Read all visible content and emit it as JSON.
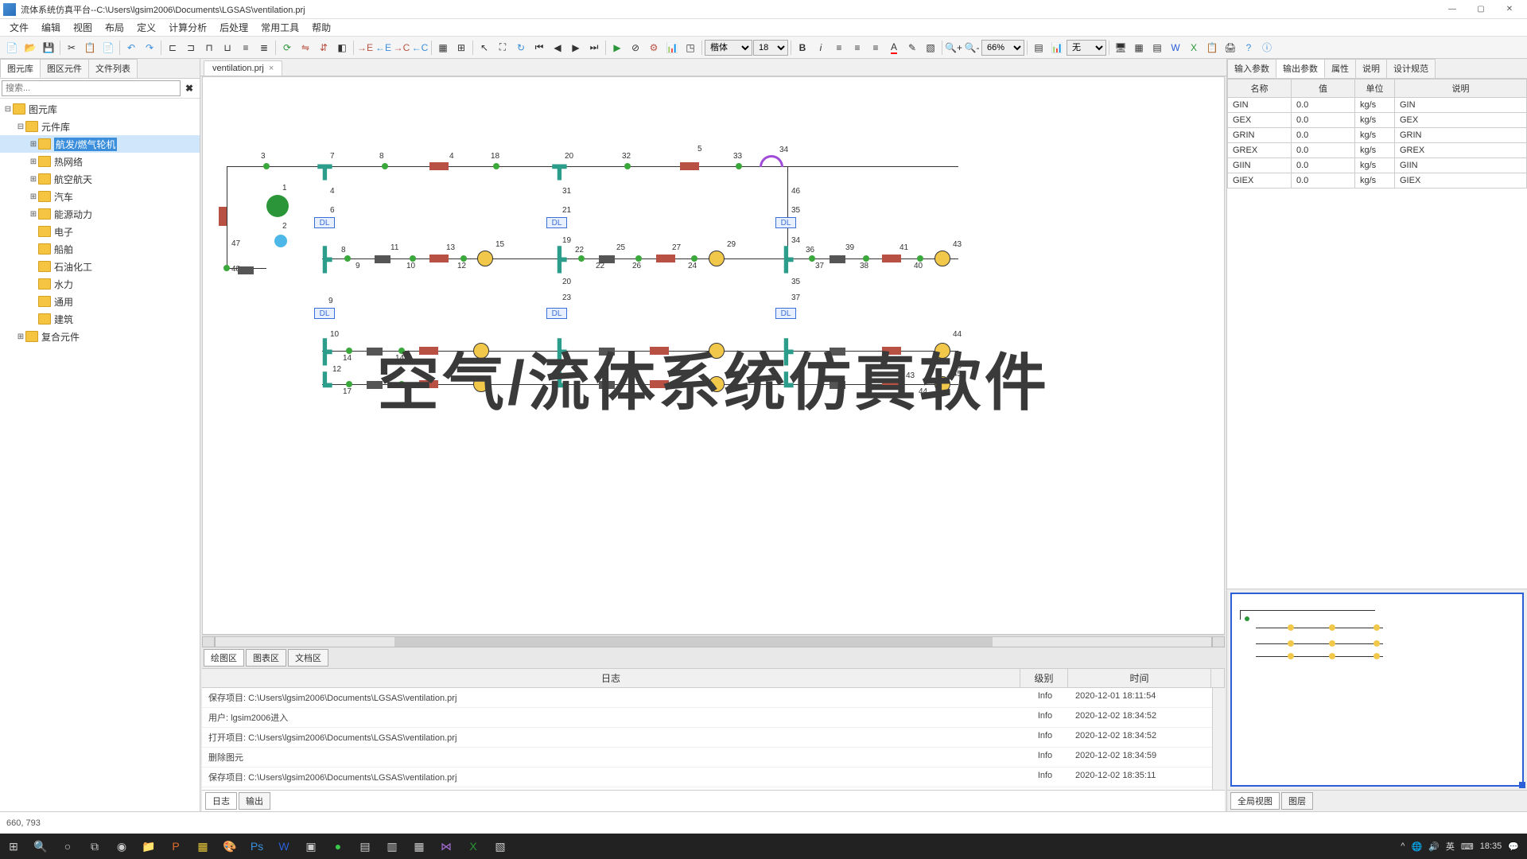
{
  "title": "流体系统仿真平台--C:\\Users\\lgsim2006\\Documents\\LGSAS\\ventilation.prj",
  "menu": [
    "文件",
    "编辑",
    "视图",
    "布局",
    "定义",
    "计算分析",
    "后处理",
    "常用工具",
    "帮助"
  ],
  "toolbar": {
    "font_select": "楷体",
    "font_size": "18",
    "zoom": "66%",
    "layer_select": "无"
  },
  "left_panel": {
    "tabs": [
      "图元库",
      "图区元件",
      "文件列表"
    ],
    "active_tab": 0,
    "search_placeholder": "搜索...",
    "tree": [
      {
        "label": "图元库",
        "depth": 0,
        "expanded": true
      },
      {
        "label": "元件库",
        "depth": 1,
        "expanded": true
      },
      {
        "label": "航发/燃气轮机",
        "depth": 2,
        "selected": true
      },
      {
        "label": "热网络",
        "depth": 2
      },
      {
        "label": "航空航天",
        "depth": 2
      },
      {
        "label": "汽车",
        "depth": 2
      },
      {
        "label": "能源动力",
        "depth": 2
      },
      {
        "label": "电子",
        "depth": 2
      },
      {
        "label": "船舶",
        "depth": 2
      },
      {
        "label": "石油化工",
        "depth": 2
      },
      {
        "label": "水力",
        "depth": 2
      },
      {
        "label": "通用",
        "depth": 2
      },
      {
        "label": "建筑",
        "depth": 2
      },
      {
        "label": "复合元件",
        "depth": 1
      }
    ]
  },
  "doc_tab": "ventilation.prj",
  "watermark_text": "空气/流体系统仿真软件",
  "bottom_tabs": [
    "绘图区",
    "图表区",
    "文档区"
  ],
  "bottom_active": 0,
  "schematic_labels": {
    "dl": "DL"
  },
  "log": {
    "headers": {
      "msg": "日志",
      "level": "级别",
      "time": "时间"
    },
    "rows": [
      {
        "msg": "保存项目: C:\\Users\\lgsim2006\\Documents\\LGSAS\\ventilation.prj",
        "level": "Info",
        "time": "2020-12-01 18:11:54"
      },
      {
        "msg": "用户: lgsim2006进入",
        "level": "Info",
        "time": "2020-12-02 18:34:52"
      },
      {
        "msg": "打开项目: C:\\Users\\lgsim2006\\Documents\\LGSAS\\ventilation.prj",
        "level": "Info",
        "time": "2020-12-02 18:34:52"
      },
      {
        "msg": "删除图元",
        "level": "Info",
        "time": "2020-12-02 18:34:59"
      },
      {
        "msg": "保存项目: C:\\Users\\lgsim2006\\Documents\\LGSAS\\ventilation.prj",
        "level": "Info",
        "time": "2020-12-02 18:35:11"
      }
    ],
    "footer_tabs": [
      "日志",
      "输出"
    ]
  },
  "right_panel": {
    "tabs": [
      "输入参数",
      "输出参数",
      "属性",
      "说明",
      "设计规范"
    ],
    "active_tab": 1,
    "headers": {
      "name": "名称",
      "value": "值",
      "unit": "单位",
      "desc": "说明"
    },
    "rows": [
      {
        "name": "GIN",
        "value": "0.0",
        "unit": "kg/s",
        "desc": "GIN"
      },
      {
        "name": "GEX",
        "value": "0.0",
        "unit": "kg/s",
        "desc": "GEX"
      },
      {
        "name": "GRIN",
        "value": "0.0",
        "unit": "kg/s",
        "desc": "GRIN"
      },
      {
        "name": "GREX",
        "value": "0.0",
        "unit": "kg/s",
        "desc": "GREX"
      },
      {
        "name": "GIIN",
        "value": "0.0",
        "unit": "kg/s",
        "desc": "GIIN"
      },
      {
        "name": "GIEX",
        "value": "0.0",
        "unit": "kg/s",
        "desc": "GIEX"
      }
    ],
    "overview_tabs": [
      "全局视图",
      "图层"
    ]
  },
  "status": "660, 793",
  "taskbar": {
    "ime": "英",
    "time": "18:35"
  }
}
